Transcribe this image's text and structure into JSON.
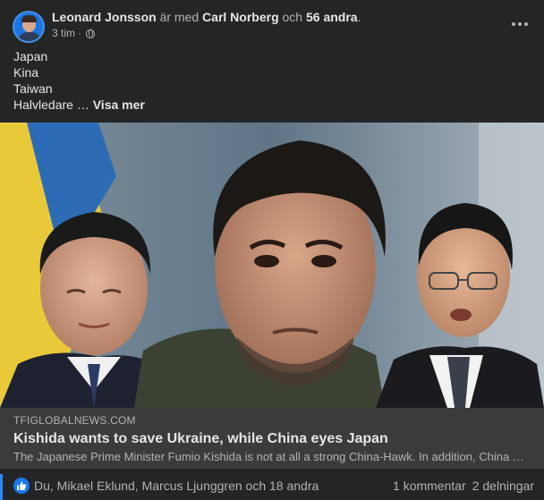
{
  "header": {
    "author": "Leonard Jonsson",
    "with_text": "är med",
    "tagged": "Carl Norberg",
    "and_text": "och",
    "others": "56 andra",
    "period": ".",
    "time": "3 tim",
    "separator": "·",
    "privacy_icon": "globe-icon",
    "menu_icon": "more-horizontal-icon"
  },
  "post_text": {
    "lines": [
      "Japan",
      "Kina",
      "Taiwan"
    ],
    "last_line": "Halvledare …",
    "see_more": "Visa mer"
  },
  "link_preview": {
    "domain": "TFIGLOBALNEWS.COM",
    "title": "Kishida wants to save Ukraine, while China eyes Japan",
    "description": "The Japanese Prime Minister Fumio Kishida is not at all a strong China-Hawk. In addition, China has been eyeing Japan for a long time"
  },
  "footer": {
    "reaction_icon": "like-icon",
    "reactions": "Du, Mikael Eklund, Marcus Ljunggren och 18 andra",
    "comments": "1 kommentar",
    "shares": "2 delningar"
  },
  "colors": {
    "background": "#242526",
    "link_box": "#3a3b3c",
    "like_blue": "#1877f2"
  }
}
